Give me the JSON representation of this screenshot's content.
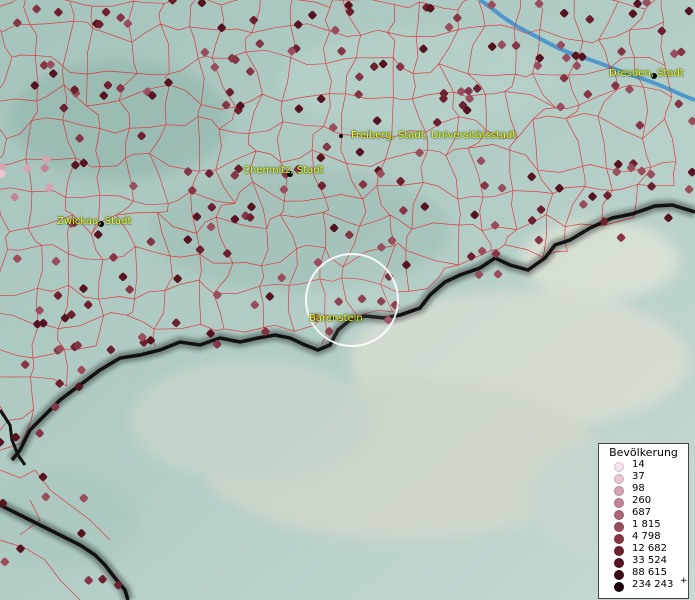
{
  "map": {
    "cities": [
      {
        "id": "dresden",
        "label": "Dresden, Stadt"
      },
      {
        "id": "freiberg",
        "label": "Freiberg, Stadt, Universitätsstadt"
      },
      {
        "id": "chemnitz",
        "label": "Chemnitz, Stadt"
      },
      {
        "id": "zwickau",
        "label": "Zwickau, Stadt"
      },
      {
        "id": "baerenstein",
        "label": "Bärenstein"
      }
    ],
    "colors": {
      "terrain": "#a9c7c0",
      "boundary": "#e0242a",
      "border": "#111111",
      "river": "#3b8fd0",
      "label": "#f2ff2a"
    }
  },
  "legend": {
    "title": "Bevölkerung",
    "plus": "+",
    "items": [
      {
        "label": "14",
        "color": "#f7e3ef"
      },
      {
        "label": "37",
        "color": "#edc6d6"
      },
      {
        "label": "98",
        "color": "#d6a3b3"
      },
      {
        "label": "260",
        "color": "#c28595"
      },
      {
        "label": "687",
        "color": "#ad6878"
      },
      {
        "label": "1 815",
        "color": "#994d5d"
      },
      {
        "label": "4 798",
        "color": "#853545"
      },
      {
        "label": "12 682",
        "color": "#6e2030"
      },
      {
        "label": "33 524",
        "color": "#551420"
      },
      {
        "label": "88 615",
        "color": "#3d0a14"
      },
      {
        "label": "234 243",
        "color": "#1a0308"
      }
    ]
  }
}
